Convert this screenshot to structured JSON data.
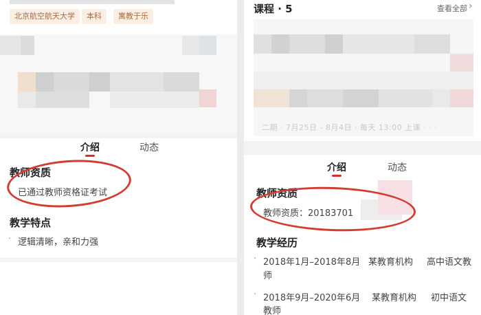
{
  "left": {
    "tags": [
      "北京航空航天大学",
      "本科",
      "寓教于乐"
    ],
    "tabs": [
      "介绍",
      "动态"
    ],
    "qualification": {
      "title": "教师资质",
      "text": "已通过教师资格证考试"
    },
    "features": {
      "title": "教学特点",
      "bullet": "·",
      "text": "逻辑清晰，亲和力强"
    }
  },
  "right": {
    "courses_title": "课程 · 5",
    "view_all": "查看全部",
    "view_all_icon": "chevron-right-icon",
    "course_blur_text": "二期 · 7月25日 - 8月4日 · 每天 13:00 上课 · · ·",
    "tabs": [
      "介绍",
      "动态"
    ],
    "qualification": {
      "title": "教师资质",
      "text": "教师资质：20183701"
    },
    "experience": {
      "title": "教学经历",
      "items": [
        {
          "line1": "2018年1月–2018年8月",
          "org": "某教育机构",
          "role": "高中语文教",
          "line2": "师"
        },
        {
          "line1": "2018年9月–2020年6月",
          "org": "某教育机构",
          "role": "初中语文",
          "line2": "教师"
        }
      ]
    }
  },
  "colors": {
    "accent": "#d6302b",
    "tag_text": "#b06a3e",
    "tag_bg": "#fbeee3"
  }
}
